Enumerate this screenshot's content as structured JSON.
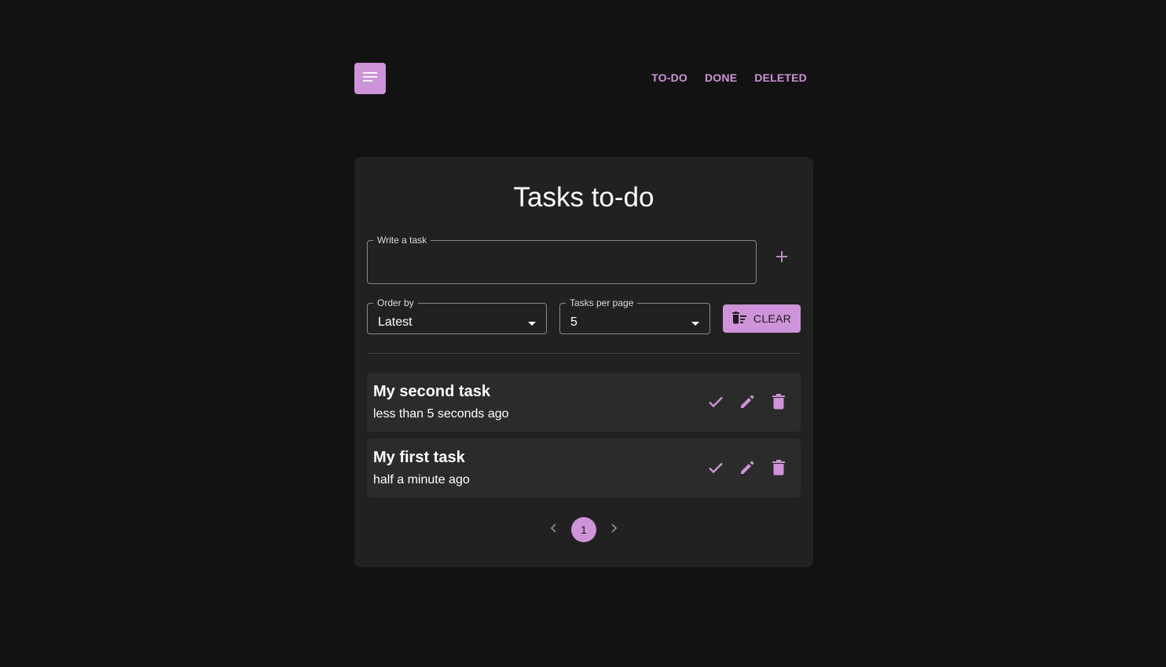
{
  "header": {
    "menu_icon": "menu-icon",
    "nav": [
      {
        "label": "TO-DO"
      },
      {
        "label": "DONE"
      },
      {
        "label": "DELETED"
      }
    ]
  },
  "main": {
    "title": "Tasks to-do",
    "task_input": {
      "label": "Write a task",
      "value": ""
    },
    "add_icon": "plus-icon",
    "order_by": {
      "label": "Order by",
      "value": "Latest"
    },
    "tasks_per_page": {
      "label": "Tasks per page",
      "value": "5"
    },
    "clear_button": {
      "label": "CLEAR",
      "icon": "delete-sweep-icon"
    },
    "tasks": [
      {
        "title": "My second task",
        "time": "less than 5 seconds ago"
      },
      {
        "title": "My first task",
        "time": "half a minute ago"
      }
    ],
    "pagination": {
      "current_page": "1"
    }
  },
  "colors": {
    "background": "#121212",
    "card": "#212121",
    "task_item": "#2b2b2b",
    "accent": "#ce93d8"
  }
}
